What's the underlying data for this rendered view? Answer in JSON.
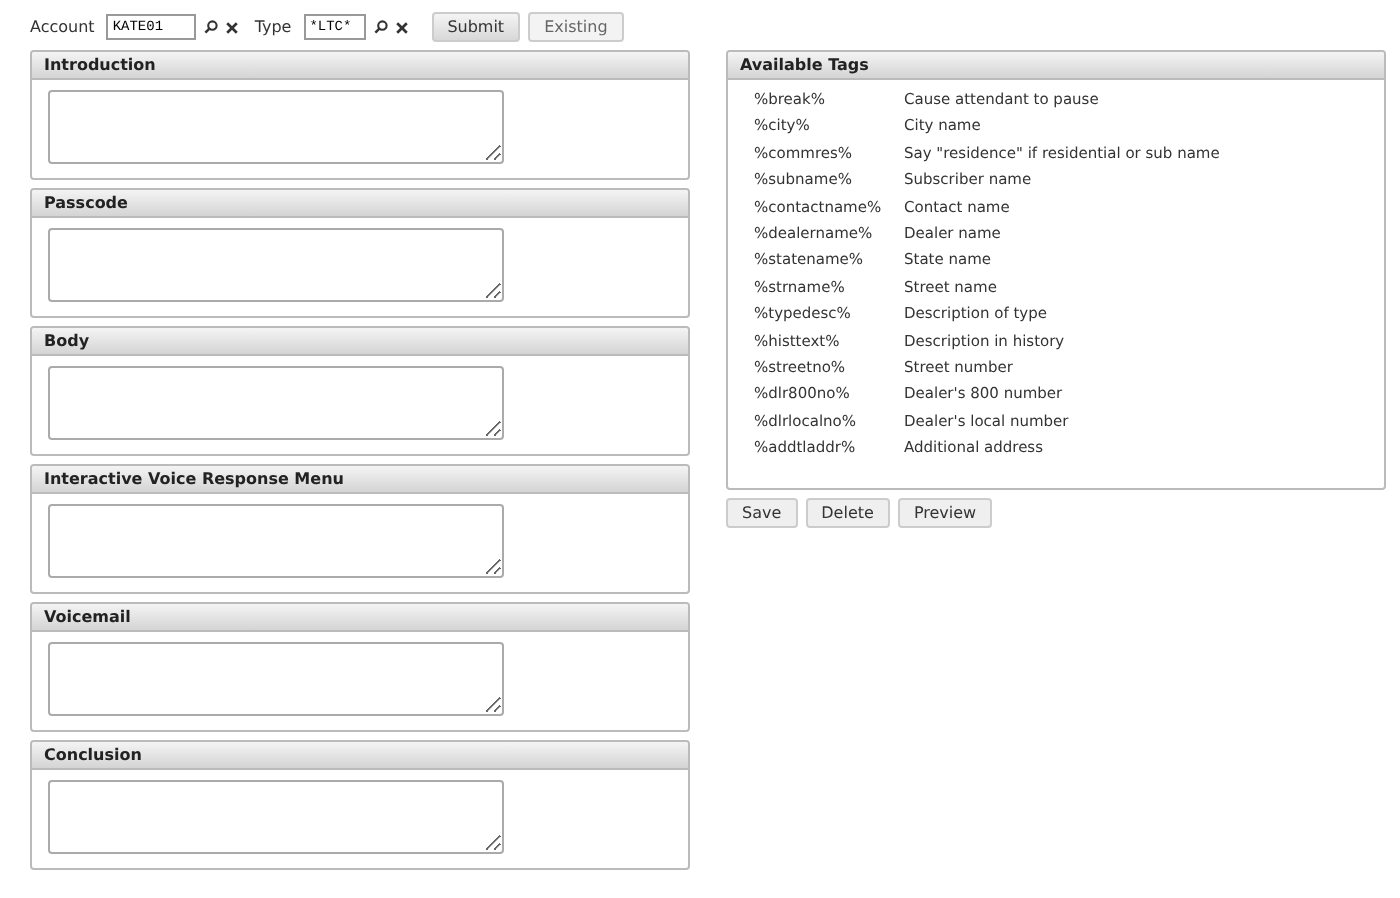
{
  "toolbar": {
    "account_label": "Account",
    "account_value": "KATE01",
    "type_label": "Type",
    "type_value": "*LTC*",
    "buttons": [
      {
        "label": "Submit",
        "selected": true
      },
      {
        "label": "Existing",
        "selected": false
      }
    ]
  },
  "sections": [
    {
      "title": "Introduction"
    },
    {
      "title": "Passcode"
    },
    {
      "title": "Body"
    },
    {
      "title": "Interactive Voice Response Menu"
    },
    {
      "title": "Voicemail"
    },
    {
      "title": "Conclusion"
    }
  ],
  "tags_panel": {
    "title": "Available Tags",
    "tags": [
      {
        "tag": "%break%",
        "description": "Cause attendant to pause"
      },
      {
        "tag": "%city%",
        "description": "City name"
      },
      {
        "tag": "%commres%",
        "description": "Say \"residence\" if residential or sub name"
      },
      {
        "tag": "%subname%",
        "description": "Subscriber name"
      },
      {
        "tag": "%contactname%",
        "description": "Contact name"
      },
      {
        "tag": "%dealername%",
        "description": "Dealer name"
      },
      {
        "tag": "%statename%",
        "description": "State name"
      },
      {
        "tag": "%strname%",
        "description": "Street name"
      },
      {
        "tag": "%typedesc%",
        "description": "Description of type"
      },
      {
        "tag": "%histtext%",
        "description": "Description in history"
      },
      {
        "tag": "%streetno%",
        "description": "Street number"
      },
      {
        "tag": "%dlr800no%",
        "description": "Dealer's 800 number"
      },
      {
        "tag": "%dlrlocalno%",
        "description": "Dealer's local number"
      },
      {
        "tag": "%addtladdr%",
        "description": "Additional address"
      }
    ]
  },
  "actions": [
    "Save",
    "Delete",
    "Preview"
  ]
}
